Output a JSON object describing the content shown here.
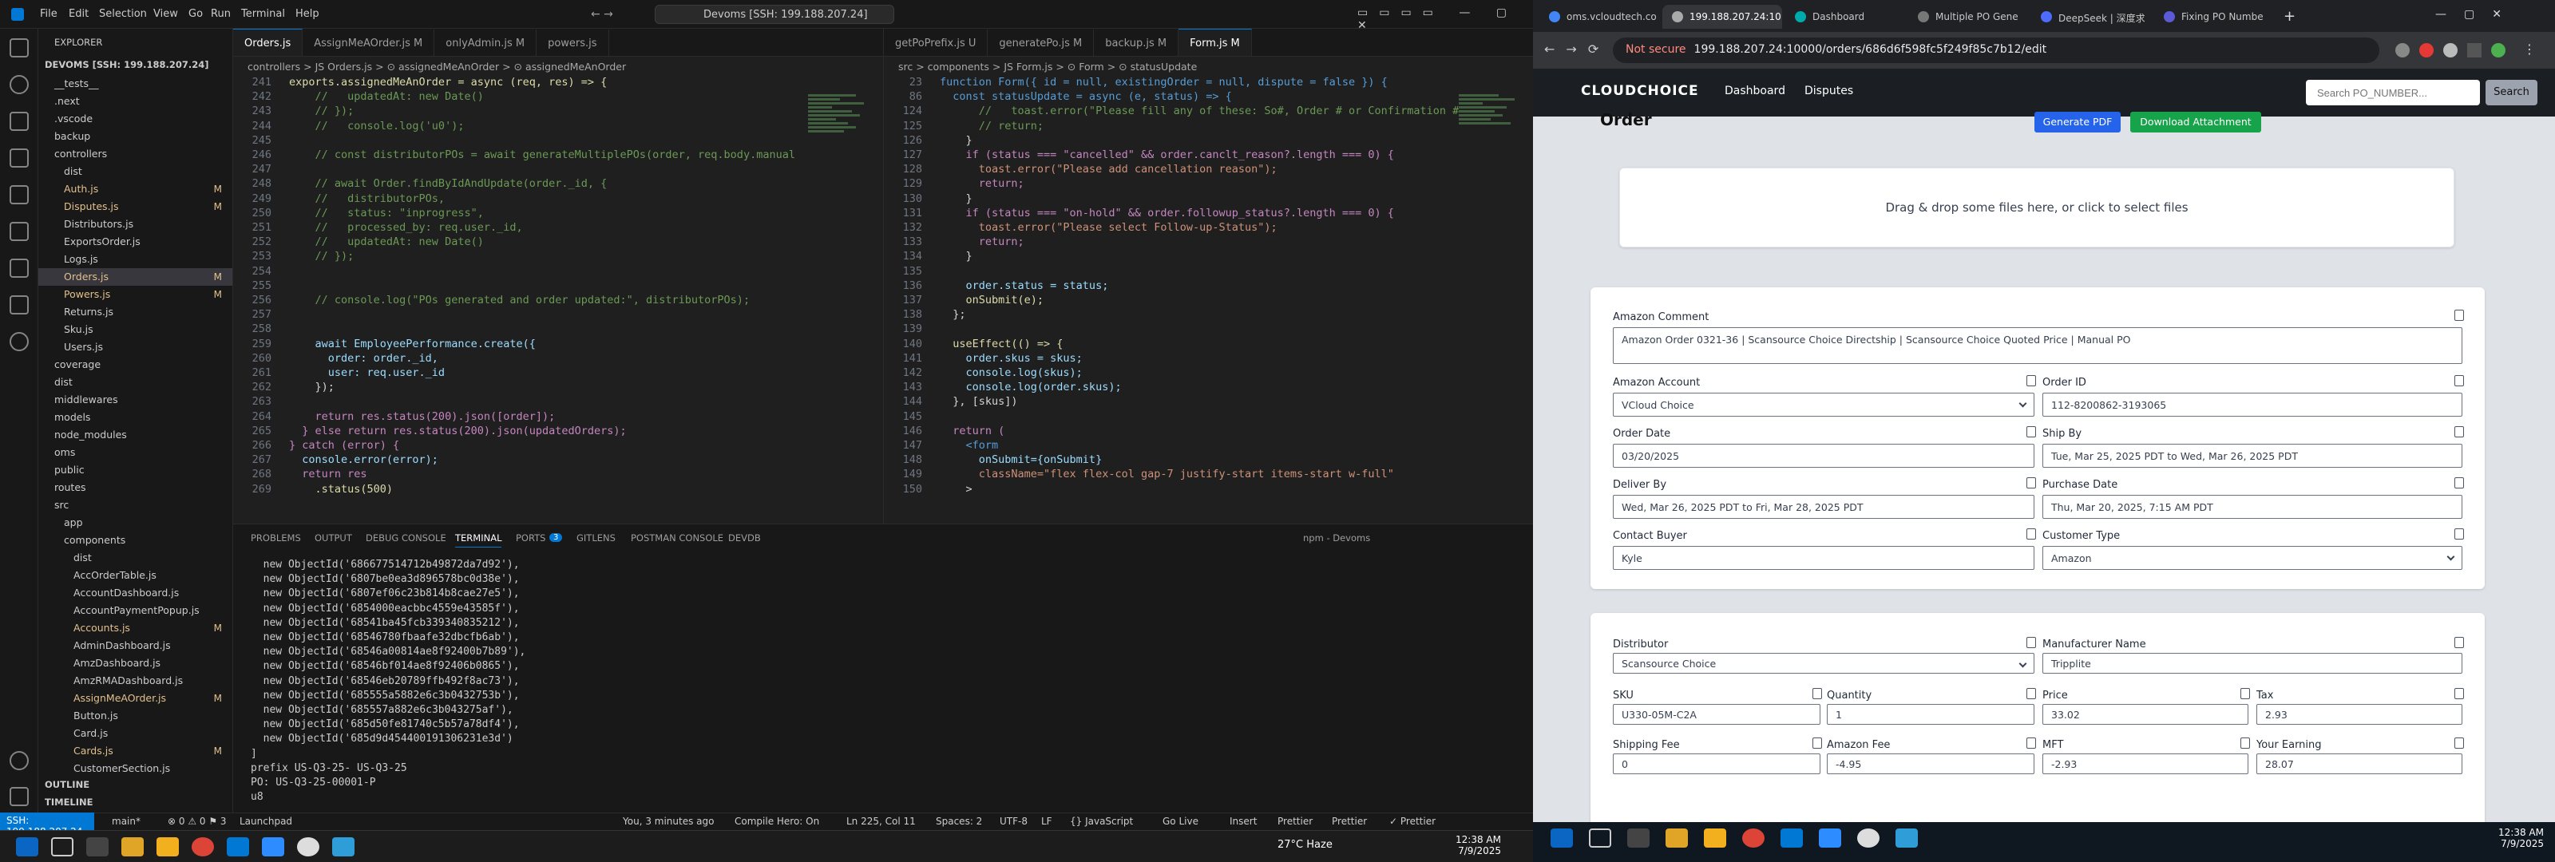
{
  "vscode": {
    "menu": [
      "File",
      "Edit",
      "Selection",
      "View",
      "Go",
      "Run",
      "Terminal",
      "Help"
    ],
    "command_center": "Devoms [SSH: 199.188.207.24]",
    "explorer": {
      "title": "EXPLORER",
      "root": "DEVOMS [SSH: 199.188.207.24]",
      "items": [
        {
          "label": "__tests__",
          "indent": 1,
          "badge": ""
        },
        {
          "label": ".next",
          "indent": 1,
          "badge": ""
        },
        {
          "label": ".vscode",
          "indent": 1,
          "badge": ""
        },
        {
          "label": "backup",
          "indent": 1,
          "badge": ""
        },
        {
          "label": "controllers",
          "indent": 1,
          "badge": ""
        },
        {
          "label": "dist",
          "indent": 2,
          "badge": ""
        },
        {
          "label": "Auth.js",
          "indent": 2,
          "badge": "M"
        },
        {
          "label": "Disputes.js",
          "indent": 2,
          "badge": "M"
        },
        {
          "label": "Distributors.js",
          "indent": 2,
          "badge": ""
        },
        {
          "label": "ExportsOrder.js",
          "indent": 2,
          "badge": ""
        },
        {
          "label": "Logs.js",
          "indent": 2,
          "badge": ""
        },
        {
          "label": "Orders.js",
          "indent": 2,
          "badge": "M"
        },
        {
          "label": "Powers.js",
          "indent": 2,
          "badge": "M"
        },
        {
          "label": "Returns.js",
          "indent": 2,
          "badge": ""
        },
        {
          "label": "Sku.js",
          "indent": 2,
          "badge": ""
        },
        {
          "label": "Users.js",
          "indent": 2,
          "badge": ""
        },
        {
          "label": "coverage",
          "indent": 1,
          "badge": ""
        },
        {
          "label": "dist",
          "indent": 1,
          "badge": ""
        },
        {
          "label": "middlewares",
          "indent": 1,
          "badge": ""
        },
        {
          "label": "models",
          "indent": 1,
          "badge": ""
        },
        {
          "label": "node_modules",
          "indent": 1,
          "badge": ""
        },
        {
          "label": "oms",
          "indent": 1,
          "badge": ""
        },
        {
          "label": "public",
          "indent": 1,
          "badge": ""
        },
        {
          "label": "routes",
          "indent": 1,
          "badge": ""
        },
        {
          "label": "src",
          "indent": 1,
          "badge": ""
        },
        {
          "label": "app",
          "indent": 2,
          "badge": ""
        },
        {
          "label": "components",
          "indent": 2,
          "badge": ""
        },
        {
          "label": "dist",
          "indent": 3,
          "badge": ""
        },
        {
          "label": "AccOrderTable.js",
          "indent": 3,
          "badge": ""
        },
        {
          "label": "AccountDashboard.js",
          "indent": 3,
          "badge": ""
        },
        {
          "label": "AccountPaymentPopup.js",
          "indent": 3,
          "badge": ""
        },
        {
          "label": "Accounts.js",
          "indent": 3,
          "badge": "M"
        },
        {
          "label": "AdminDashboard.js",
          "indent": 3,
          "badge": ""
        },
        {
          "label": "AmzDashboard.js",
          "indent": 3,
          "badge": ""
        },
        {
          "label": "AmzRMADashboard.js",
          "indent": 3,
          "badge": ""
        },
        {
          "label": "AssignMeAOrder.js",
          "indent": 3,
          "badge": "M"
        },
        {
          "label": "Button.js",
          "indent": 3,
          "badge": ""
        },
        {
          "label": "Card.js",
          "indent": 3,
          "badge": ""
        },
        {
          "label": "Cards.js",
          "indent": 3,
          "badge": "M"
        },
        {
          "label": "CustomerSection.js",
          "indent": 3,
          "badge": ""
        }
      ],
      "outline": "OUTLINE",
      "timeline": "TIMELINE"
    },
    "left_tabs": [
      "Orders.js",
      "AssignMeAOrder.js M",
      "onlyAdmin.js M",
      "powers.js"
    ],
    "left_crumb": "controllers > JS Orders.js > ⊙ assignedMeAnOrder > ⊙ assignedMeAnOrder",
    "left_code": [
      {
        "n": "241",
        "t": "exports.assignedMeAnOrder = async (req, res) => {",
        "c": "fn"
      },
      {
        "n": "242",
        "t": "    //   updatedAt: new Date()",
        "c": "cm"
      },
      {
        "n": "243",
        "t": "    // });",
        "c": "cm"
      },
      {
        "n": "244",
        "t": "    //   console.log('u0');",
        "c": "cm"
      },
      {
        "n": "245",
        "t": "",
        "c": "tx"
      },
      {
        "n": "246",
        "t": "    // const distributorPOs = await generateMultiplePOs(order, req.body.manual",
        "c": "cm"
      },
      {
        "n": "247",
        "t": "",
        "c": "tx"
      },
      {
        "n": "248",
        "t": "    // await Order.findByIdAndUpdate(order._id, {",
        "c": "cm"
      },
      {
        "n": "249",
        "t": "    //   distributorPOs,",
        "c": "cm"
      },
      {
        "n": "250",
        "t": "    //   status: \"inprogress\",",
        "c": "cm"
      },
      {
        "n": "251",
        "t": "    //   processed_by: req.user._id,",
        "c": "cm"
      },
      {
        "n": "252",
        "t": "    //   updatedAt: new Date()",
        "c": "cm"
      },
      {
        "n": "253",
        "t": "    // });",
        "c": "cm"
      },
      {
        "n": "254",
        "t": "",
        "c": "tx"
      },
      {
        "n": "255",
        "t": "",
        "c": "tx"
      },
      {
        "n": "256",
        "t": "    // console.log(\"POs generated and order updated:\", distributorPOs);",
        "c": "cm"
      },
      {
        "n": "257",
        "t": "",
        "c": "tx"
      },
      {
        "n": "258",
        "t": "",
        "c": "tx"
      },
      {
        "n": "259",
        "t": "    await EmployeePerformance.create({",
        "c": "vr"
      },
      {
        "n": "260",
        "t": "      order: order._id,",
        "c": "vr"
      },
      {
        "n": "261",
        "t": "      user: req.user._id",
        "c": "vr"
      },
      {
        "n": "262",
        "t": "    });",
        "c": "tx"
      },
      {
        "n": "263",
        "t": "",
        "c": "tx"
      },
      {
        "n": "264",
        "t": "    return res.status(200).json([order]);",
        "c": "kw"
      },
      {
        "n": "265",
        "t": "  } else return res.status(200).json(updatedOrders);",
        "c": "kw"
      },
      {
        "n": "266",
        "t": "} catch (error) {",
        "c": "kw"
      },
      {
        "n": "267",
        "t": "  console.error(error);",
        "c": "vr"
      },
      {
        "n": "268",
        "t": "  return res",
        "c": "kw"
      },
      {
        "n": "269",
        "t": "    .status(500)",
        "c": "fn"
      }
    ],
    "right_tabs": [
      "getPoPrefix.js U",
      "generatePo.js M",
      "backup.js M",
      "Form.js M"
    ],
    "right_crumb": "src > components > JS Form.js > ⊙ Form > ⊙ statusUpdate",
    "right_code": [
      {
        "n": "23",
        "t": "function Form({ id = null, existingOrder = null, dispute = false }) {",
        "c": "kb"
      },
      {
        "n": "86",
        "t": "  const statusUpdate = async (e, status) => {",
        "c": "kb"
      },
      {
        "n": "124",
        "t": "      //   toast.error(\"Please fill any of these: So#, Order # or Confirmation #\")",
        "c": "cm"
      },
      {
        "n": "125",
        "t": "      // return;",
        "c": "cm"
      },
      {
        "n": "126",
        "t": "    }",
        "c": "tx"
      },
      {
        "n": "127",
        "t": "    if (status === \"cancelled\" && order.canclt_reason?.length === 0) {",
        "c": "kw"
      },
      {
        "n": "128",
        "t": "      toast.error(\"Please add cancellation reason\");",
        "c": "st"
      },
      {
        "n": "129",
        "t": "      return;",
        "c": "kw"
      },
      {
        "n": "130",
        "t": "    }",
        "c": "tx"
      },
      {
        "n": "131",
        "t": "    if (status === \"on-hold\" && order.followup_status?.length === 0) {",
        "c": "kw"
      },
      {
        "n": "132",
        "t": "      toast.error(\"Please select Follow-up-Status\");",
        "c": "st"
      },
      {
        "n": "133",
        "t": "      return;",
        "c": "kw"
      },
      {
        "n": "134",
        "t": "    }",
        "c": "tx"
      },
      {
        "n": "135",
        "t": "",
        "c": "tx"
      },
      {
        "n": "136",
        "t": "    order.status = status;",
        "c": "vr"
      },
      {
        "n": "137",
        "t": "    onSubmit(e);",
        "c": "fn"
      },
      {
        "n": "138",
        "t": "  };",
        "c": "tx"
      },
      {
        "n": "139",
        "t": "",
        "c": "tx"
      },
      {
        "n": "140",
        "t": "  useEffect(() => {",
        "c": "fn"
      },
      {
        "n": "141",
        "t": "    order.skus = skus;",
        "c": "vr"
      },
      {
        "n": "142",
        "t": "    console.log(skus);",
        "c": "vr"
      },
      {
        "n": "143",
        "t": "    console.log(order.skus);",
        "c": "vr"
      },
      {
        "n": "144",
        "t": "  }, [skus])",
        "c": "tx"
      },
      {
        "n": "145",
        "t": "",
        "c": "tx"
      },
      {
        "n": "146",
        "t": "  return (",
        "c": "kw"
      },
      {
        "n": "147",
        "t": "    <form",
        "c": "kb"
      },
      {
        "n": "148",
        "t": "      onSubmit={onSubmit}",
        "c": "vr"
      },
      {
        "n": "149",
        "t": "      className=\"flex flex-col gap-7 justify-start items-start w-full\"",
        "c": "st"
      },
      {
        "n": "150",
        "t": "    >",
        "c": "tx"
      }
    ],
    "panel_tabs": [
      "PROBLEMS",
      "OUTPUT",
      "DEBUG CONSOLE",
      "TERMINAL",
      "PORTS",
      "GITLENS",
      "POSTMAN CONSOLE",
      "DEVDB"
    ],
    "ports_badge": "3",
    "terminal_label": "npm - Devoms",
    "terminal_lines": [
      "  new ObjectId('686677514712b49872da7d92'),",
      "  new ObjectId('6807be0ea3d896578bc0d38e'),",
      "  new ObjectId('6807ef06c23b814b8cae27e5'),",
      "  new ObjectId('6854000eacbbc4559e43585f'),",
      "  new ObjectId('68541ba45fcb339340835212'),",
      "  new ObjectId('68546780fbaafe32dbcfb6ab'),",
      "  new ObjectId('68546a00814ae8f92400b7b89'),",
      "  new ObjectId('68546bf014ae8f92406b0865'),",
      "  new ObjectId('68546eb20789ffb492f8ac73'),",
      "  new ObjectId('685555a5882e6c3b0432753b'),",
      "  new ObjectId('685557a882e6c3b043275af'),",
      "  new ObjectId('685d50fe81740c5b57a78df4'),",
      "  new ObjectId('685d9d454400191306231e3d')",
      "]",
      "prefix US-Q3-25- US-Q3-25",
      "PO: US-Q3-25-00001-P",
      "u8"
    ],
    "status_items": [
      "SSH: 199.188.207.24",
      "main*",
      "⊗ 0 ⚠ 0 ⚑ 3",
      "Launchpad",
      "You, 3 minutes ago",
      "Compile Hero: On",
      "Ln 225, Col 11",
      "Spaces: 2",
      "UTF-8",
      "LF",
      "{} JavaScript",
      "Go Live",
      "Insert",
      "Prettier",
      "Prettier",
      "✓ Prettier"
    ],
    "weather": "27°C  Haze",
    "clock_time": "12:38 AM",
    "clock_date": "7/9/2025"
  },
  "chrome": {
    "tabs": [
      "oms.vcloudtech.co",
      "199.188.207.24:10",
      "Dashboard",
      "Multiple PO Gene",
      "DeepSeek | 深度求",
      "Fixing PO Numbe"
    ],
    "not_secure": "Not secure",
    "url": "199.188.207.24:10000/orders/686d6f598fc5f249f85c7b12/edit",
    "nav_links": [
      "Dashboard",
      "Disputes"
    ],
    "logo": "CLOUDCHOICE",
    "search_placeholder": "Search PO_NUMBER...",
    "search_button": "Search",
    "page_heading": "Order",
    "btn_generate": "Generate PDF",
    "btn_download": "Download Attachment",
    "dropzone": "Drag & drop some files here, or click to select files",
    "fields": {
      "amazon_comment_label": "Amazon Comment",
      "amazon_comment": "Amazon Order 0321-36 | Scansource Choice Directship | Scansource Choice Quoted Price | Manual PO",
      "amazon_account_label": "Amazon Account",
      "amazon_account": "VCloud Choice",
      "order_id_label": "Order ID",
      "order_id": "112-8200862-3193065",
      "order_date_label": "Order Date",
      "order_date": "03/20/2025",
      "ship_by_label": "Ship By",
      "ship_by": "Tue, Mar 25, 2025 PDT to Wed, Mar 26, 2025 PDT",
      "deliver_by_label": "Deliver By",
      "deliver_by": "Wed, Mar 26, 2025 PDT to Fri, Mar 28, 2025 PDT",
      "purchase_date_label": "Purchase Date",
      "purchase_date": "Thu, Mar 20, 2025, 7:15 AM PDT",
      "contact_buyer_label": "Contact Buyer",
      "contact_buyer": "Kyle",
      "customer_type_label": "Customer Type",
      "customer_type": "Amazon",
      "distributor_label": "Distributor",
      "distributor": "Scansource Choice",
      "manufacturer_label": "Manufacturer Name",
      "manufacturer": "Tripplite",
      "sku_label": "SKU",
      "sku": "U330-05M-C2A",
      "quantity_label": "Quantity",
      "quantity": "1",
      "price_label": "Price",
      "price": "33.02",
      "tax_label": "Tax",
      "tax": "2.93",
      "shipping_label": "Shipping Fee",
      "shipping": "0",
      "amazon_fee_label": "Amazon Fee",
      "amazon_fee": "-4.95",
      "mft_label": "MFT",
      "mft": "-2.93",
      "earning_label": "Your Earning",
      "earning": "28.07"
    }
  },
  "colors": {
    "vscode_accent": "#0078d4",
    "cloud_nav": "#1b1f23",
    "generate_btn": "#2563eb",
    "download_btn": "#16a34a",
    "page_bg": "#dfe3e8"
  }
}
